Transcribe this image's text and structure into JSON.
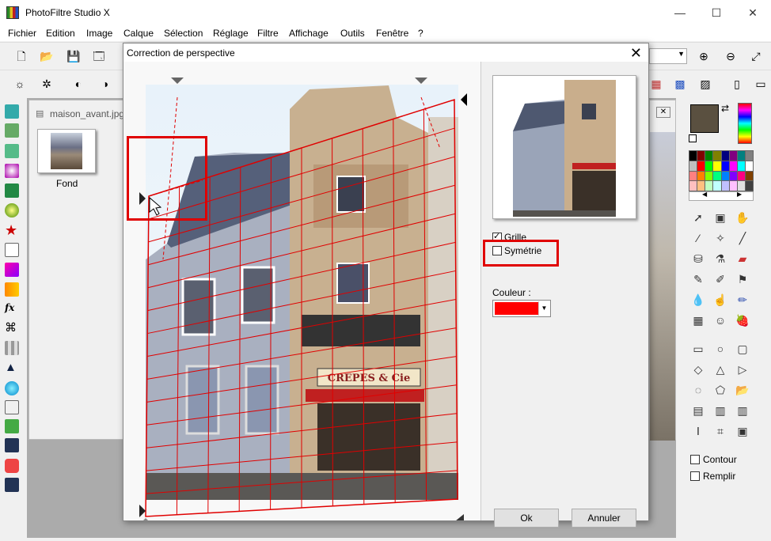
{
  "app": {
    "title": "PhotoFiltre Studio X"
  },
  "window_controls": {
    "minimize": "—",
    "maximize": "☐",
    "close": "✕"
  },
  "menu": [
    "Fichier",
    "Edition",
    "Image",
    "Calque",
    "Sélection",
    "Réglage",
    "Filtre",
    "Affichage",
    "Outils",
    "Fenêtre",
    "?"
  ],
  "document": {
    "title": "maison_avant.jpg",
    "layer_name": "Fond"
  },
  "dialog": {
    "title": "Correction de perspective",
    "close": "✕",
    "grid_label": "Grille",
    "grid_checked": true,
    "symmetry_label": "Symétrie",
    "symmetry_checked": false,
    "color_label": "Couleur :",
    "color_value": "#ff0000",
    "ok_label": "Ok",
    "cancel_label": "Annuler",
    "storefront_sign": "CREPES & Cie"
  },
  "right_panel": {
    "foreground_color": "#5a5040",
    "contour_label": "Contour",
    "fill_label": "Remplir",
    "palette": [
      "#000000",
      "#800000",
      "#008000",
      "#808000",
      "#000080",
      "#800080",
      "#008080",
      "#808080",
      "#c0c0c0",
      "#ff0000",
      "#00ff00",
      "#ffff00",
      "#0000ff",
      "#ff00ff",
      "#00ffff",
      "#ffffff",
      "#ff8080",
      "#ff8000",
      "#80ff00",
      "#00ff80",
      "#0080ff",
      "#8000ff",
      "#ff0080",
      "#804000",
      "#ffc0c0",
      "#ffc080",
      "#c0ffc0",
      "#c0ffff",
      "#c0c0ff",
      "#ffc0ff",
      "#e0e0e0",
      "#404040"
    ]
  },
  "colors": {
    "grid_red": "#e00000",
    "highlight": "#e00000"
  }
}
